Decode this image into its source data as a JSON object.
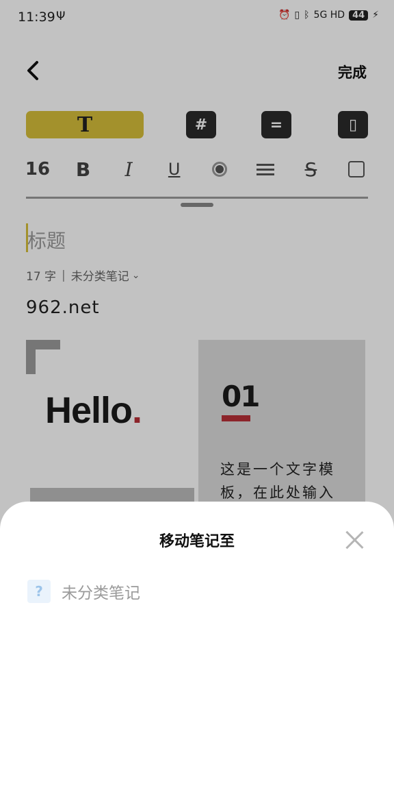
{
  "status_bar": {
    "time": "11:39",
    "usb": "Ψ",
    "network": "5G HD",
    "battery": "44"
  },
  "header": {
    "done_label": "完成"
  },
  "template_tabs": [
    {
      "icon": "text-template-icon",
      "glyph": "T",
      "selected": true
    },
    {
      "icon": "hashtag-template-icon",
      "glyph": "#"
    },
    {
      "icon": "list-template-icon",
      "glyph": "="
    },
    {
      "icon": "column-template-icon",
      "glyph": "▯"
    }
  ],
  "format_toolbar": {
    "font_size": "16",
    "bold": "B",
    "italic": "I",
    "underline": "U",
    "strikethrough": "S"
  },
  "note": {
    "title_placeholder": "标题",
    "word_count": "17 字",
    "category": "未分类笔记",
    "body_text": "962.net",
    "template": {
      "hello_text": "Hello",
      "hello_dot": ".",
      "number": "01",
      "paragraph": "这是一个文字模板，在此处输入"
    }
  },
  "move_sheet": {
    "title": "移动笔记至",
    "folders": [
      {
        "icon": "question-icon",
        "glyph": "?",
        "label": "未分类笔记"
      }
    ]
  },
  "colors": {
    "accent_yellow": "#d6bf3a",
    "accent_red": "#b83038",
    "overlay": "rgba(0,0,0,0.24)"
  }
}
